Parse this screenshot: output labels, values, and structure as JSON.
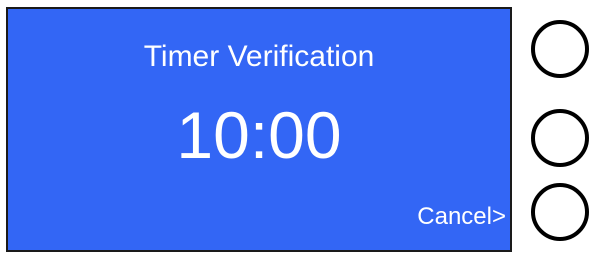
{
  "screen": {
    "title": "Timer Verification",
    "timer_value": "10:00",
    "cancel_label": "Cancel>",
    "background_color": "#3366f5",
    "text_color": "#ffffff"
  },
  "side_buttons": [
    {
      "icon": "circle-button"
    },
    {
      "icon": "circle-button"
    },
    {
      "icon": "circle-button"
    }
  ]
}
